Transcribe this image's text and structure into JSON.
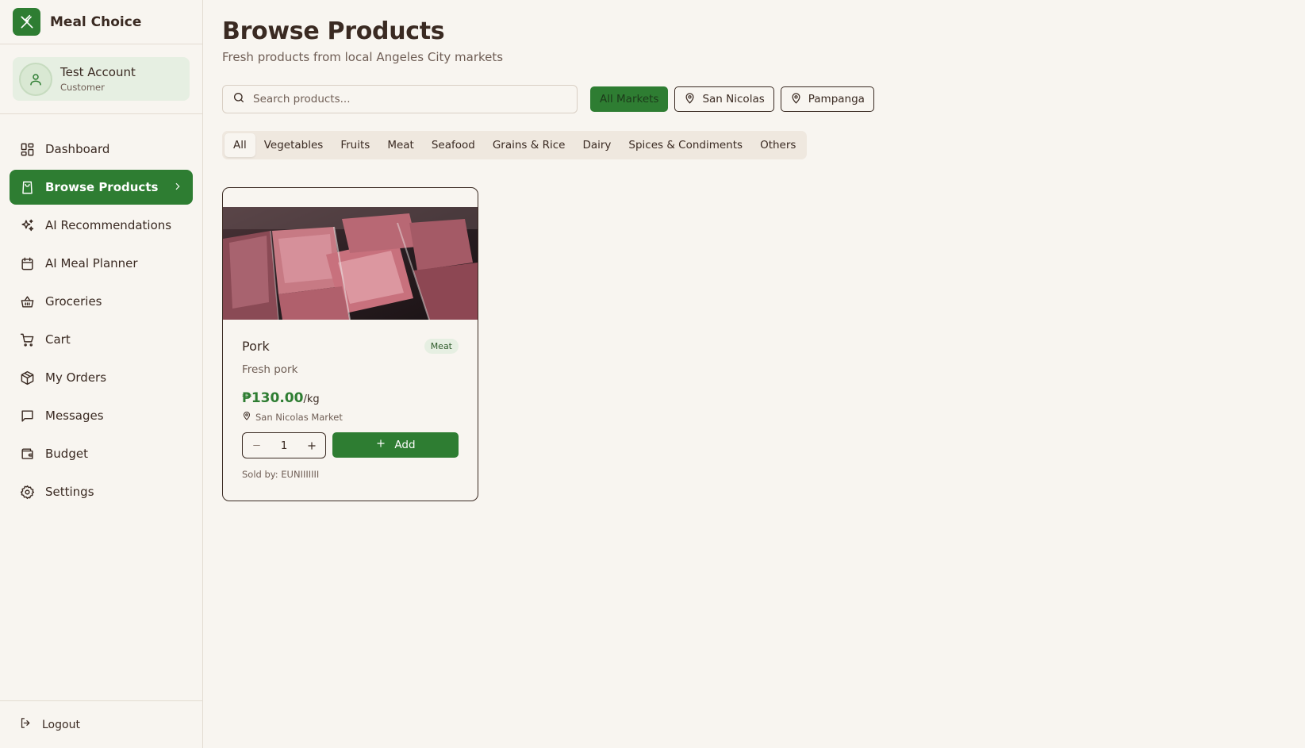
{
  "app": {
    "title": "Meal Choice"
  },
  "account": {
    "name": "Test Account",
    "role": "Customer"
  },
  "sidebar": {
    "items": [
      {
        "label": "Dashboard",
        "icon": "dashboard-icon"
      },
      {
        "label": "Browse Products",
        "icon": "shopping-bag-icon",
        "active": true
      },
      {
        "label": "AI Recommendations",
        "icon": "sparkles-icon"
      },
      {
        "label": "AI Meal Planner",
        "icon": "calendar-icon"
      },
      {
        "label": "Groceries",
        "icon": "basket-icon"
      },
      {
        "label": "Cart",
        "icon": "cart-icon"
      },
      {
        "label": "My Orders",
        "icon": "package-icon"
      },
      {
        "label": "Messages",
        "icon": "message-icon"
      },
      {
        "label": "Budget",
        "icon": "wallet-icon"
      },
      {
        "label": "Settings",
        "icon": "gear-icon"
      }
    ],
    "logout_label": "Logout"
  },
  "page": {
    "title": "Browse Products",
    "subtitle": "Fresh products from local Angeles City markets"
  },
  "search": {
    "placeholder": "Search products...",
    "value": ""
  },
  "markets": [
    {
      "label": "All Markets",
      "active": true
    },
    {
      "label": "San Nicolas",
      "icon": "map-pin-icon"
    },
    {
      "label": "Pampanga",
      "icon": "map-pin-icon"
    }
  ],
  "categories": {
    "active": "All",
    "items": [
      "All",
      "Vegetables",
      "Fruits",
      "Meat",
      "Seafood",
      "Grains & Rice",
      "Dairy",
      "Spices & Condiments",
      "Others"
    ]
  },
  "products": [
    {
      "name": "Pork",
      "category": "Meat",
      "description": "Fresh pork",
      "price": "₱130.00",
      "unit": "/kg",
      "market": "San Nicolas Market",
      "quantity": "1",
      "add_label": "Add",
      "sold_by": "Sold by: EUNIIIIIII"
    }
  ],
  "colors": {
    "primary": "#2e7d32",
    "background": "#f8f5f0",
    "text": "#3a2a22",
    "muted": "#6f5e55",
    "accent_light": "#e6efe2"
  }
}
